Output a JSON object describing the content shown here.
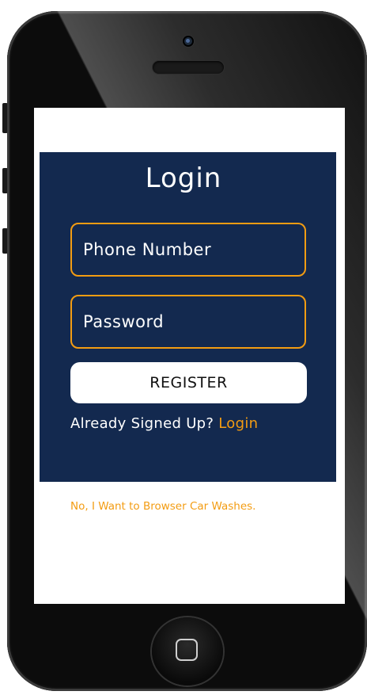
{
  "login": {
    "title": "Login",
    "phone_placeholder": "Phone Number",
    "password_placeholder": "Password",
    "register_label": "REGISTER",
    "already_text": "Already Signed Up?",
    "login_link": "Login"
  },
  "browse_link": "No, I Want to Browser Car Washes.",
  "colors": {
    "panel": "#13294f",
    "accent": "#f39c12",
    "button_bg": "#ffffff"
  },
  "icons": {
    "home": "home-button-icon",
    "camera": "front-camera-icon",
    "speaker": "earpiece-speaker-icon"
  }
}
